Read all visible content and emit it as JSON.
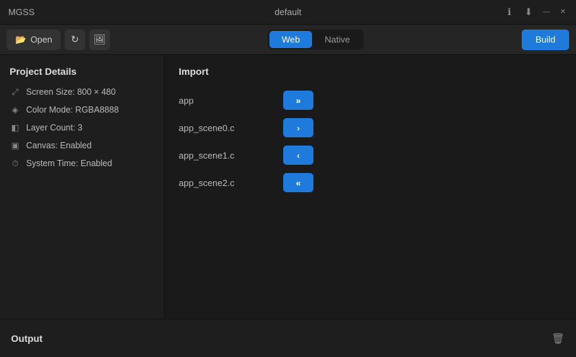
{
  "app": {
    "title": "MGSS",
    "window_title": "default"
  },
  "titlebar": {
    "app_name": "MGSS",
    "project_name": "default",
    "icons": {
      "info": "ℹ",
      "download": "⬇",
      "minimize": "—",
      "close": "✕"
    }
  },
  "toolbar": {
    "open_label": "Open",
    "tabs": [
      {
        "id": "web",
        "label": "Web",
        "active": true
      },
      {
        "id": "native",
        "label": "Native",
        "active": false
      }
    ],
    "build_label": "Build"
  },
  "left_panel": {
    "title": "Project Details",
    "details": [
      {
        "id": "screen-size",
        "icon": "⤢",
        "label": "Screen Size: 800 × 480"
      },
      {
        "id": "color-mode",
        "icon": "◈",
        "label": "Color Mode: RGBA8888"
      },
      {
        "id": "layer-count",
        "icon": "◧",
        "label": "Layer Count: 3"
      },
      {
        "id": "canvas",
        "icon": "▣",
        "label": "Canvas: Enabled"
      },
      {
        "id": "system-time",
        "icon": "⏰",
        "label": "System Time: Enabled"
      }
    ]
  },
  "right_panel": {
    "title": "Import",
    "items": [
      {
        "id": "app",
        "name": "app",
        "action": ">>",
        "type": "double-right"
      },
      {
        "id": "app_scene0",
        "name": "app_scene0.c",
        "action": ">",
        "type": "single-right"
      },
      {
        "id": "app_scene1",
        "name": "app_scene1.c",
        "action": "<",
        "type": "single-left"
      },
      {
        "id": "app_scene2",
        "name": "app_scene2.c",
        "action": "<<",
        "type": "double-left"
      }
    ]
  },
  "output_panel": {
    "title": "Output",
    "trash_icon": "🗑"
  }
}
